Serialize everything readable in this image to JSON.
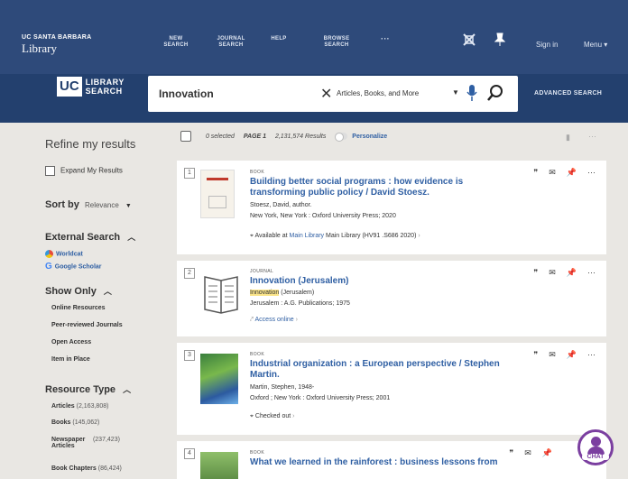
{
  "header": {
    "brand_top": "UC SANTA BARBARA",
    "brand_bottom": "Library",
    "nav": [
      "NEW SEARCH",
      "JOURNAL SEARCH",
      "HELP",
      "BROWSE SEARCH",
      "···"
    ],
    "sign_in": "Sign in",
    "menu": "Menu ▾"
  },
  "search": {
    "logo_uc": "UC",
    "logo_text": "LIBRARY SEARCH",
    "query": "Innovation",
    "scope": "Articles, Books, and More",
    "advanced": "ADVANCED SEARCH"
  },
  "sidebar": {
    "title": "Refine my results",
    "expand": "Expand My Results",
    "sort_label": "Sort by",
    "sort_value": "Relevance",
    "external_title": "External Search",
    "external_links": [
      "Worldcat",
      "Google Scholar"
    ],
    "show_only_title": "Show Only",
    "show_only": [
      "Online Resources",
      "Peer-reviewed Journals",
      "Open Access",
      "Item in Place"
    ],
    "resource_type_title": "Resource Type",
    "resource_types": [
      {
        "label": "Articles",
        "count": "(2,163,808)"
      },
      {
        "label": "Books",
        "count": "(145,062)"
      },
      {
        "label": "Newspaper Articles",
        "count": "(237,423)"
      },
      {
        "label": "Book Chapters",
        "count": "(86,424)"
      }
    ]
  },
  "results_header": {
    "selected": "0 selected",
    "page": "PAGE 1",
    "count": "2,131,574 Results",
    "personalize": "Personalize"
  },
  "results": [
    {
      "num": "1",
      "type": "BOOK",
      "title": "Building better social programs : how evidence is transforming public policy / David Stoesz.",
      "author": "Stoesz, David, author.",
      "pub": "New York, New York : Oxford University Press; 2020",
      "avail_prefix": "Available at",
      "avail_link": "Main Library",
      "avail_rest": "Main Library (HV91 .S686 2020)",
      "colors": {
        "thumb": "#f6f2ea",
        "accent": "#c0392b"
      }
    },
    {
      "num": "2",
      "type": "JOURNAL",
      "title": "Innovation (Jerusalem)",
      "author_hl": "Innovation",
      "author_rest": " (Jerusalem)",
      "pub": "Jerusalem : A.G. Publications; 1975",
      "avail_link": "Access online"
    },
    {
      "num": "3",
      "type": "BOOK",
      "title": "Industrial organization : a European perspective / Stephen Martin.",
      "author": "Martin, Stephen, 1948-",
      "pub": "Oxford ; New York : Oxford University Press; 2001",
      "avail_prefix": "Checked out"
    },
    {
      "num": "4",
      "type": "BOOK",
      "title": "What we learned in the rainforest : business lessons from"
    }
  ],
  "chat_label": "CHAT",
  "colors": {
    "header": "#2e4a7a",
    "search_row": "#23406e",
    "link": "#2f5fa3",
    "highlight": "#fbe58a",
    "chat": "#7b3fa0"
  }
}
